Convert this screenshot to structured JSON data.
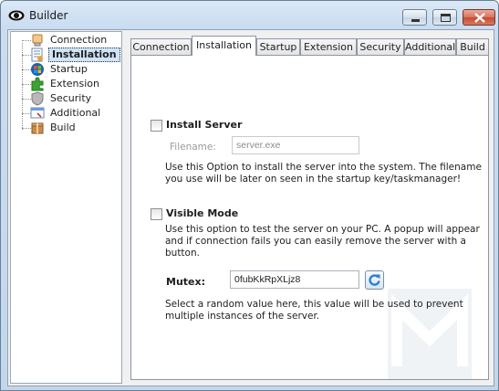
{
  "window": {
    "title": "Builder"
  },
  "tree": {
    "items": [
      {
        "label": "Connection",
        "icon": "connection-icon"
      },
      {
        "label": "Installation",
        "icon": "installation-icon"
      },
      {
        "label": "Startup",
        "icon": "startup-icon"
      },
      {
        "label": "Extension",
        "icon": "extension-icon"
      },
      {
        "label": "Security",
        "icon": "security-icon"
      },
      {
        "label": "Additional",
        "icon": "additional-icon"
      },
      {
        "label": "Build",
        "icon": "build-icon"
      }
    ]
  },
  "tabs": [
    "Connection",
    "Installation",
    "Startup",
    "Extension",
    "Security",
    "Additional",
    "Build"
  ],
  "installation": {
    "install_server_label": "Install Server",
    "filename_label": "Filename:",
    "filename_value": "server.exe",
    "install_desc_1": "Use this Option to install the server into the system. The filename",
    "install_desc_2": "you use will be later on seen in the startup key/taskmanager!",
    "visible_mode_label": "Visible Mode",
    "visible_desc_1": "Use this option to test the server on your PC. A popup will appear",
    "visible_desc_2": "and if connection fails you can easily remove the server with a",
    "visible_desc_3": "button.",
    "mutex_label": "Mutex:",
    "mutex_value": "0fubKkRpXLjz8",
    "mutex_desc_1": "Select a random value here, this value will be used to prevent",
    "mutex_desc_2": "multiple instances of the server."
  },
  "colors": {
    "accent": "#3a7fd0",
    "selection": "#cfe4f8",
    "title_bar": "#c9dcf0"
  }
}
